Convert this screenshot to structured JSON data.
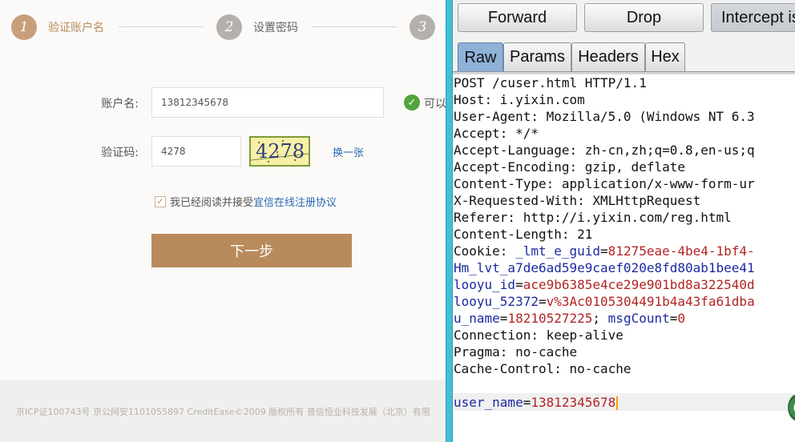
{
  "web_page": {
    "steps": [
      {
        "number": "1",
        "label": "验证账户名",
        "active": true
      },
      {
        "number": "2",
        "label": "设置密码",
        "active": false
      },
      {
        "number": "3",
        "label": "",
        "active": false
      }
    ],
    "form": {
      "username_label": "账户名:",
      "username_value": "13812345678",
      "username_status": "可以",
      "captcha_label": "验证码:",
      "captcha_value": "4278",
      "captcha_image_text": "4278",
      "captcha_refresh": "换一张",
      "agree_text": "我已经阅读并接受",
      "agree_link": "宜信在线注册协议",
      "agree_checked": true,
      "next_button": "下一步"
    },
    "footer": "京ICP证100743号 京公网安1101055897 CreditEase©2009 版权所有 普信恒业科技发展（北京）有限"
  },
  "burp": {
    "toolbar": {
      "forward": "Forward",
      "drop": "Drop",
      "intercept": "Intercept is"
    },
    "tabs": [
      {
        "label": "Raw",
        "active": true
      },
      {
        "label": "Params",
        "active": false
      },
      {
        "label": "Headers",
        "active": false
      },
      {
        "label": "Hex",
        "active": false
      }
    ],
    "request": {
      "request_line": "POST /cuser.html HTTP/1.1",
      "host": "Host: i.yixin.com",
      "user_agent": "User-Agent: Mozilla/5.0 (Windows NT 6.3",
      "accept": "Accept: */*",
      "accept_language": "Accept-Language: zh-cn,zh;q=0.8,en-us;q",
      "accept_encoding": "Accept-Encoding: gzip, deflate",
      "content_type": "Content-Type: application/x-www-form-ur",
      "x_requested_with": "X-Requested-With: XMLHttpRequest",
      "referer": "Referer: http://i.yixin.com/reg.html",
      "content_length": "Content-Length: 21",
      "cookie_prefix": "Cookie: ",
      "cookie_lmt_key": "_lmt_e_guid",
      "cookie_lmt_val": "81275eae-4be4-1bf4-",
      "cookie_hm_key": "Hm_lvt_a7de6ad59e9caef020e8fd80ab1bee41",
      "cookie_looyu_id_key": "looyu_id",
      "cookie_looyu_id_val": "ace9b6385e4ce29e901bd8a322540d",
      "cookie_looyu_52372_key": "looyu_52372",
      "cookie_looyu_52372_val": "v%3Ac0105304491b4a43fa61dba",
      "cookie_uname_key": "u_name",
      "cookie_uname_val": "18210527225",
      "cookie_msg_key": "msgCount",
      "cookie_msg_val": "0",
      "connection": "Connection: keep-alive",
      "pragma": "Pragma: no-cache",
      "cache_control": "Cache-Control: no-cache",
      "body_key": "user_name",
      "body_val": "13812345678"
    }
  },
  "colors": {
    "accent_brown": "#b98b5c",
    "inactive_step": "#b3b0ad",
    "link_blue": "#2a6ab5",
    "success_green": "#52a43c",
    "burp_key": "#1c2aa0",
    "burp_value": "#b32424",
    "divider_cyan": "#41c1d4"
  }
}
